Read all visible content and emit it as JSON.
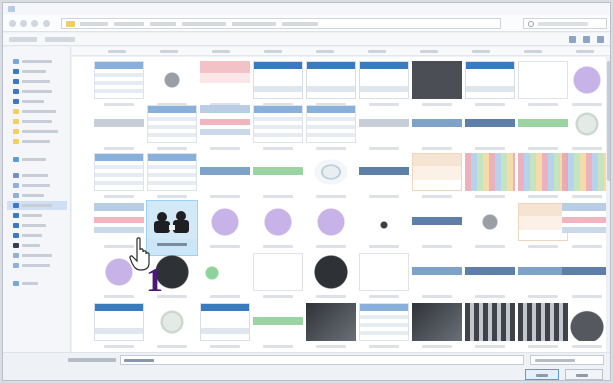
{
  "window": {
    "title": ""
  },
  "address": {
    "crumb_count": 6
  },
  "search": {
    "placeholder": ""
  },
  "sidebar": {
    "selected_index": 15
  },
  "grid": {
    "selected_tile": {
      "row": 3,
      "col": 2
    }
  },
  "footer": {
    "filename_label": "",
    "filename_value": "",
    "open_label": "",
    "cancel_label": ""
  },
  "overlay": {
    "step_number": "1"
  },
  "icons": {
    "folder": "folder-icon",
    "search": "search-icon",
    "pointer": "hand-pointer-icon"
  },
  "colors": {
    "selection": "#cde6f7",
    "selection_border": "#99d1ff",
    "step_number": "#4a177a",
    "primary_button": "#5a9bd8"
  }
}
